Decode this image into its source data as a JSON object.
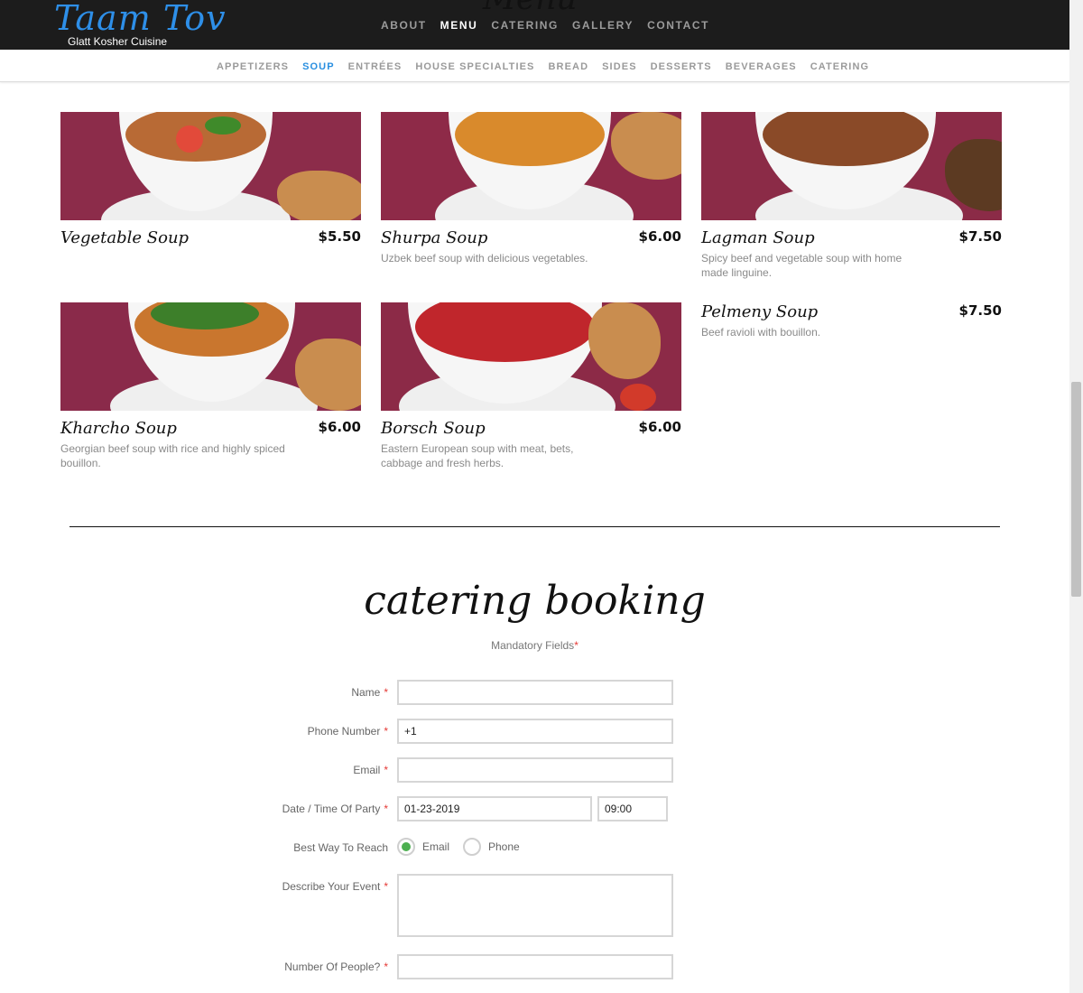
{
  "header": {
    "logo_title": "Taam Tov",
    "logo_subtitle": "Glatt Kosher Cuisine",
    "page_heading_partial": "Menu",
    "nav": [
      "ABOUT",
      "MENU",
      "CATERING",
      "GALLERY",
      "CONTACT"
    ],
    "nav_active": "MENU"
  },
  "subnav": {
    "items": [
      "APPETIZERS",
      "SOUP",
      "ENTRÉES",
      "HOUSE SPECIALTIES",
      "BREAD",
      "SIDES",
      "DESSERTS",
      "BEVERAGES",
      "CATERING"
    ],
    "active": "SOUP"
  },
  "menu_items": [
    {
      "name": "Vegetable Soup",
      "price": "$5.50",
      "desc": ""
    },
    {
      "name": "Shurpa Soup",
      "price": "$6.00",
      "desc": "Uzbek beef soup with delicious vegetables."
    },
    {
      "name": "Lagman Soup",
      "price": "$7.50",
      "desc": "Spicy beef and vegetable soup with home made linguine."
    },
    {
      "name": "Kharcho Soup",
      "price": "$6.00",
      "desc": "Georgian beef soup with rice and highly spiced bouillon."
    },
    {
      "name": "Borsch Soup",
      "price": "$6.00",
      "desc": "Eastern European soup with meat, bets, cabbage and fresh herbs."
    },
    {
      "name": "Pelmeny Soup",
      "price": "$7.50",
      "desc": "Beef ravioli with bouillon."
    }
  ],
  "booking": {
    "title": "catering booking",
    "mandatory_note": "Mandatory Fields",
    "required_mark": "*",
    "fields": {
      "name_label": "Name",
      "phone_label": "Phone Number",
      "phone_value": "+1",
      "email_label": "Email",
      "date_label": "Date / Time Of Party",
      "date_value": "01-23-2019",
      "time_value": "09:00",
      "reach_label": "Best Way To Reach",
      "reach_options": [
        "Email",
        "Phone"
      ],
      "reach_selected": "Email",
      "event_label": "Describe Your Event",
      "people_label": "Number Of People?"
    }
  },
  "colors": {
    "accent": "#2a8fe0",
    "header_bg": "#1c1c1c",
    "required": "#e53935",
    "radio_on": "#4caf50"
  }
}
